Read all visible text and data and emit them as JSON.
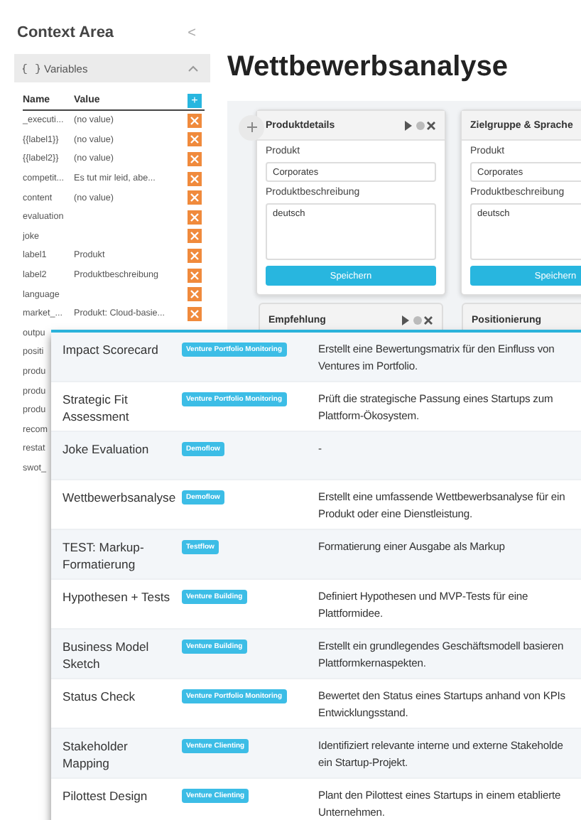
{
  "sidebar": {
    "title": "Context Area",
    "collapse": "<",
    "panel": {
      "title": "Variables",
      "expanded": true,
      "columns": [
        "Name",
        "Value"
      ],
      "add": "+",
      "rows": [
        {
          "name": "_executi...",
          "value": "(no value)"
        },
        {
          "name": "{{label1}}",
          "value": "(no value)"
        },
        {
          "name": "{{label2}}",
          "value": "(no value)"
        },
        {
          "name": "competit...",
          "value": "Es tut mir leid, abe..."
        },
        {
          "name": "content",
          "value": "(no value)"
        },
        {
          "name": "evaluation"
        },
        {
          "name": "joke"
        },
        {
          "name": "label1",
          "value": "Produkt"
        },
        {
          "name": "label2",
          "value": "Produktbeschreibung"
        },
        {
          "name": "language"
        },
        {
          "name": "market_...",
          "value": "Produkt: Cloud-basie..."
        }
      ],
      "covered_rows": [
        "outpu",
        "positi",
        "produ",
        "produ",
        "produ",
        "recom",
        "restat",
        "swot_"
      ]
    }
  },
  "title": "Wettbewerbsanalyse",
  "nodes": [
    {
      "title": "Produktdetails",
      "fields": [
        {
          "label": "Produkt",
          "value": "Corporates",
          "kind": "input"
        },
        {
          "label": "Produktbeschreibung",
          "value": "deutsch",
          "kind": "textarea"
        }
      ],
      "button": "Speichern"
    },
    {
      "title": "Zielgruppe & Sprache",
      "fields": [
        {
          "label": "Produkt",
          "value": "Corporates",
          "kind": "input"
        },
        {
          "label": "Produktbeschreibung",
          "value": "deutsch",
          "kind": "textarea"
        }
      ],
      "button": "Speichern"
    }
  ],
  "lower_nodes": [
    "Empfehlung",
    "Positionierung"
  ],
  "flows": [
    {
      "name": "Impact Scorecard",
      "tag": "Venture Portfolio Monitoring",
      "description": [
        "Erstellt eine Bewertungsmatrix für den Einfluss von",
        "Ventures im Portfolio."
      ]
    },
    {
      "name": "Strategic Fit Assessment",
      "tag": "Venture Portfolio Monitoring",
      "description": [
        "Prüft die strategische Passung eines Startups zum",
        "Plattform-Ökosystem."
      ]
    },
    {
      "name": "Joke Evaluation",
      "tag": "Demoflow",
      "description": [
        "-"
      ]
    },
    {
      "name": "Wettbewerbsanalyse",
      "tag": "Demoflow",
      "description": [
        "Erstellt eine umfassende Wettbewerbsanalyse für ein",
        "Produkt oder eine Dienstleistung."
      ]
    },
    {
      "name": "TEST: Markup-Formatierung",
      "tag": "Testflow",
      "description": [
        "Formatierung einer Ausgabe als Markup"
      ]
    },
    {
      "name": "Hypothesen + Tests",
      "tag": "Venture Building",
      "description": [
        "Definiert Hypothesen und MVP-Tests für eine",
        "Plattformidee."
      ]
    },
    {
      "name": "Business Model Sketch",
      "tag": "Venture Building",
      "description": [
        "Erstellt ein grundlegendes Geschäftsmodell basieren",
        "Plattformkernaspekten."
      ]
    },
    {
      "name": "Status Check",
      "tag": "Venture Portfolio Monitoring",
      "description": [
        "Bewertet den Status eines Startups anhand von KPIs",
        "Entwicklungsstand."
      ]
    },
    {
      "name": "Stakeholder Mapping",
      "tag": "Venture Clienting",
      "description": [
        "Identifiziert relevante interne und externe Stakeholde",
        "ein Startup-Projekt."
      ]
    },
    {
      "name": "Pilottest Design",
      "tag": "Venture Clienting",
      "description": [
        "Plant den Pilottest eines Startups in einem etablierte",
        "Unternehmen."
      ]
    }
  ]
}
